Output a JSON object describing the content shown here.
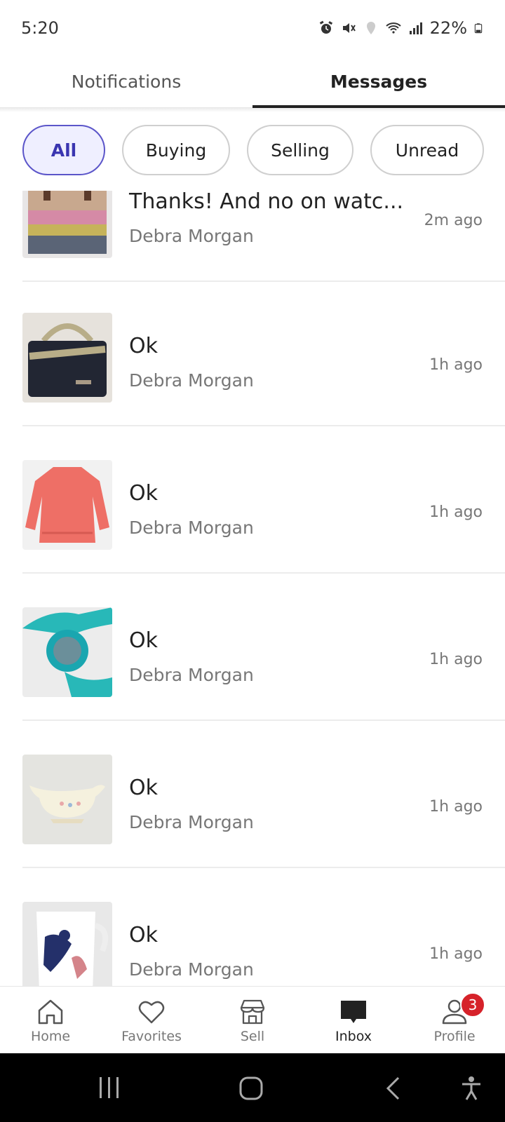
{
  "status_bar": {
    "time": "5:20",
    "battery": "22%",
    "icons": [
      "alarm-icon",
      "mute-icon",
      "location-icon",
      "wifi-icon",
      "signal-icon",
      "battery-icon"
    ]
  },
  "tabs": [
    {
      "label": "Notifications",
      "active": false
    },
    {
      "label": "Messages",
      "active": true
    }
  ],
  "filters": {
    "all": "All",
    "buying": "Buying",
    "selling": "Selling",
    "unread": "Unread",
    "selected": "All"
  },
  "messages": [
    {
      "title": "Thanks! And no on watc...",
      "sender": "Debra Morgan",
      "time": "2m ago",
      "thumb": "bag-pink-icon"
    },
    {
      "title": "Ok",
      "sender": "Debra Morgan",
      "time": "1h ago",
      "thumb": "bag-black-icon"
    },
    {
      "title": "Ok",
      "sender": "Debra Morgan",
      "time": "1h ago",
      "thumb": "pink-top-icon"
    },
    {
      "title": "Ok",
      "sender": "Debra Morgan",
      "time": "1h ago",
      "thumb": "teal-watch-icon"
    },
    {
      "title": "Ok",
      "sender": "Debra Morgan",
      "time": "1h ago",
      "thumb": "gravy-boat-icon"
    },
    {
      "title": "Ok",
      "sender": "Debra Morgan",
      "time": "1h ago",
      "thumb": "mug-icon"
    }
  ],
  "bottom_nav": {
    "home": "Home",
    "favorites": "Favorites",
    "sell": "Sell",
    "inbox": "Inbox",
    "profile": "Profile",
    "profile_badge": "3",
    "active": "Inbox"
  },
  "colors": {
    "accent": "#3a35b0",
    "chip_active_bg": "#efefff",
    "badge": "#d6222a"
  }
}
